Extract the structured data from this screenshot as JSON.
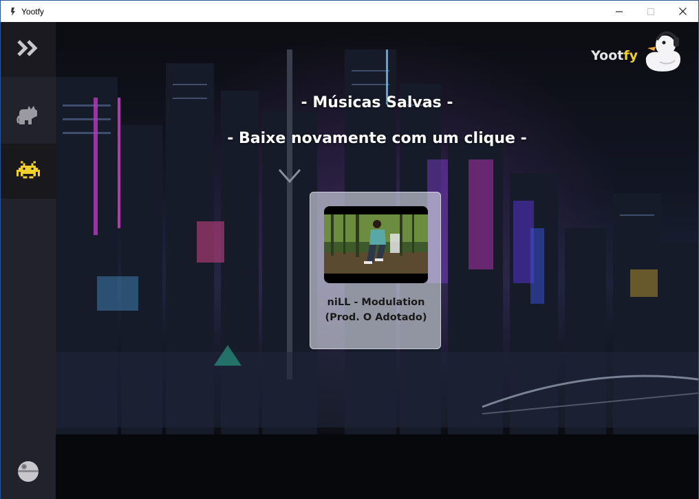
{
  "window": {
    "title": "Yootfy"
  },
  "sidebar": {
    "toggle_icon": "double-chevron-right-icon",
    "items": [
      {
        "name": "cat",
        "icon": "cat-icon",
        "active": false
      },
      {
        "name": "saved",
        "icon": "space-invader-icon",
        "active": true
      }
    ],
    "footer_icon": "death-star-icon"
  },
  "logo": {
    "text_part1": "Yoot",
    "text_part2": "fy",
    "icon": "duck-with-headphones-icon"
  },
  "main": {
    "heading": "- Músicas Salvas -",
    "subheading": "- Baixe novamente com um clique -",
    "songs": [
      {
        "title": "niLL - Modulation (Prod. O Adotado)",
        "thumbnail": "man-sitting-in-forest-photo"
      }
    ]
  },
  "colors": {
    "sidebar_bg": "#22222c",
    "accent_yellow": "#f2d02a",
    "card_bg": "rgba(220,225,235,0.62)"
  }
}
